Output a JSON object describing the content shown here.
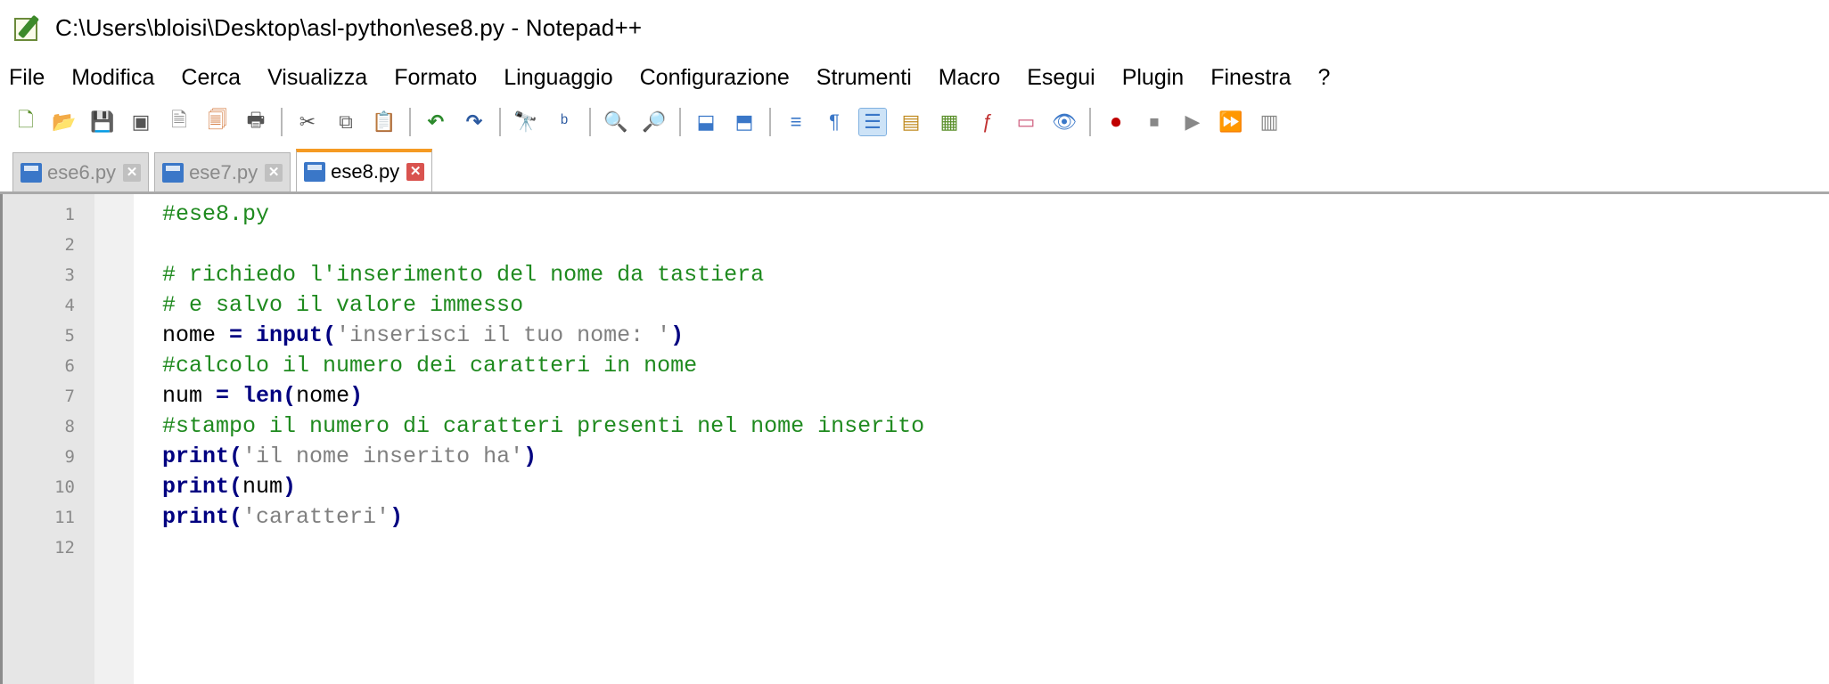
{
  "window": {
    "title": "C:\\Users\\bloisi\\Desktop\\asl-python\\ese8.py - Notepad++"
  },
  "menu": [
    "File",
    "Modifica",
    "Cerca",
    "Visualizza",
    "Formato",
    "Linguaggio",
    "Configurazione",
    "Strumenti",
    "Macro",
    "Esegui",
    "Plugin",
    "Finestra",
    "?"
  ],
  "tabs": [
    {
      "label": "ese6.py",
      "active": false
    },
    {
      "label": "ese7.py",
      "active": false
    },
    {
      "label": "ese8.py",
      "active": true
    }
  ],
  "toolbar_icons": [
    "new-file-icon",
    "open-file-icon",
    "save-icon",
    "save-all-icon",
    "close-icon",
    "close-all-icon",
    "print-icon",
    "cut-icon",
    "copy-icon",
    "paste-icon",
    "undo-icon",
    "redo-icon",
    "find-icon",
    "replace-icon",
    "zoom-in-icon",
    "zoom-out-icon",
    "sync-vertical-icon",
    "sync-horizontal-icon",
    "word-wrap-icon",
    "show-all-chars-icon",
    "indent-guide-icon",
    "udl-icon",
    "doc-map-icon",
    "function-list-icon",
    "folder-workspace-icon",
    "monitoring-icon",
    "record-macro-icon",
    "stop-macro-icon",
    "play-macro-icon",
    "run-macro-multiple-icon",
    "save-macro-icon"
  ],
  "editor": {
    "lines": [
      {
        "num": "1",
        "text": "#ese8.py"
      },
      {
        "num": "2",
        "text": ""
      },
      {
        "num": "3",
        "text": "# richiedo l'inserimento del nome da tastiera"
      },
      {
        "num": "4",
        "text": "# e salvo il valore immesso"
      },
      {
        "num": "5",
        "text": "nome = input('inserisci il tuo nome: ')"
      },
      {
        "num": "6",
        "text": "#calcolo il numero dei caratteri in nome"
      },
      {
        "num": "7",
        "text": "num = len(nome)"
      },
      {
        "num": "8",
        "text": "#stampo il numero di caratteri presenti nel nome inserito"
      },
      {
        "num": "9",
        "text": "print('il nome inserito ha')"
      },
      {
        "num": "10",
        "text": "print(num)"
      },
      {
        "num": "11",
        "text": "print('caratteri')"
      },
      {
        "num": "12",
        "text": ""
      }
    ]
  }
}
